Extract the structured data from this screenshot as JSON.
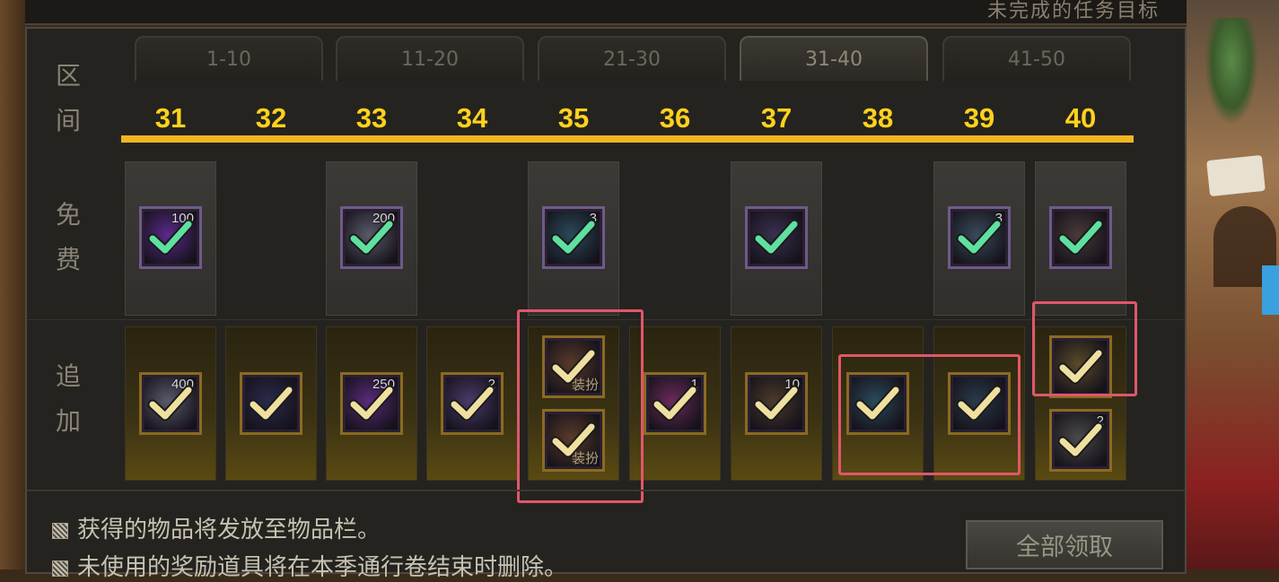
{
  "title": {
    "text": "未完成的任务目标"
  },
  "tabs": [
    {
      "label": "1-10",
      "active": false
    },
    {
      "label": "11-20",
      "active": false
    },
    {
      "label": "21-30",
      "active": false
    },
    {
      "label": "31-40",
      "active": true
    },
    {
      "label": "41-50",
      "active": false
    }
  ],
  "side_labels": {
    "range": [
      "区",
      "间"
    ],
    "free": [
      "免",
      "费"
    ],
    "bonus": [
      "追",
      "加"
    ]
  },
  "levels": [
    "31",
    "32",
    "33",
    "34",
    "35",
    "36",
    "37",
    "38",
    "39",
    "40"
  ],
  "free_items": [
    {
      "level": "31",
      "qty": "100",
      "claimed": true,
      "color": "#5a2a8a",
      "icon": "purple-orb-icon"
    },
    {
      "level": "33",
      "qty": "200",
      "claimed": true,
      "color": "#5a5a6a",
      "icon": "silver-coin-icon"
    },
    {
      "level": "35",
      "qty": "3",
      "claimed": true,
      "color": "#2a4a5a",
      "icon": "gold-emblem-icon"
    },
    {
      "level": "37",
      "qty": "",
      "claimed": true,
      "color": "#3a3050",
      "icon": "dark-ring-icon"
    },
    {
      "level": "39",
      "qty": "3",
      "claimed": true,
      "color": "#3a4a5a",
      "icon": "blue-ring-icon"
    },
    {
      "level": "40",
      "qty": "",
      "claimed": true,
      "color": "#4a3a3a",
      "icon": "scroll-icon"
    }
  ],
  "bonus_items": [
    {
      "level": "31",
      "qty": "400",
      "tag": "",
      "claimed": true,
      "color": "#5a5a6a",
      "icon": "silver-coin-icon"
    },
    {
      "level": "32",
      "qty": "",
      "tag": "",
      "claimed": true,
      "color": "#2a2a4a",
      "icon": "dark-shard-icon"
    },
    {
      "level": "33",
      "qty": "250",
      "tag": "",
      "claimed": true,
      "color": "#5a2a7a",
      "icon": "purple-orb-icon"
    },
    {
      "level": "34",
      "qty": "2",
      "tag": "",
      "claimed": true,
      "color": "#4a3a6a",
      "icon": "purple-crystal-icon"
    },
    {
      "level": "35",
      "qty": "",
      "tag": "装扮",
      "claimed": true,
      "color": "#5a3a2a",
      "icon": "costume-box-icon"
    },
    {
      "level": "35",
      "qty": "",
      "tag": "装扮",
      "claimed": true,
      "color": "#5a3a2a",
      "icon": "costume-box-icon"
    },
    {
      "level": "36",
      "qty": "1",
      "tag": "",
      "claimed": true,
      "color": "#6a2a5a",
      "icon": "pink-gem-icon"
    },
    {
      "level": "37",
      "qty": "10",
      "tag": "",
      "claimed": true,
      "color": "#4a3a2a",
      "icon": "golden-shard-icon"
    },
    {
      "level": "38",
      "qty": "",
      "tag": "",
      "claimed": true,
      "color": "#2a4a5a",
      "icon": "teal-card-icon"
    },
    {
      "level": "39",
      "qty": "",
      "tag": "",
      "claimed": true,
      "color": "#2a3a4a",
      "icon": "blue-shard-icon"
    },
    {
      "level": "40",
      "qty": "",
      "tag": "",
      "claimed": true,
      "color": "#5a4a2a",
      "icon": "golden-chest-icon"
    },
    {
      "level": "40",
      "qty": "2",
      "tag": "",
      "claimed": true,
      "color": "#4a4a4a",
      "icon": "grey-stone-icon"
    }
  ],
  "notes": [
    "获得的物品将发放至物品栏。",
    "未使用的奖励道具将在本季通行卷结束时删除。"
  ],
  "claim_all_label": "全部领取",
  "colors": {
    "level_number": "#ffd21c",
    "level_bar": "#f0b620",
    "check_free": "#5fe0a0",
    "check_bonus": "#f0e0a0",
    "highlight": "#e0576a"
  }
}
